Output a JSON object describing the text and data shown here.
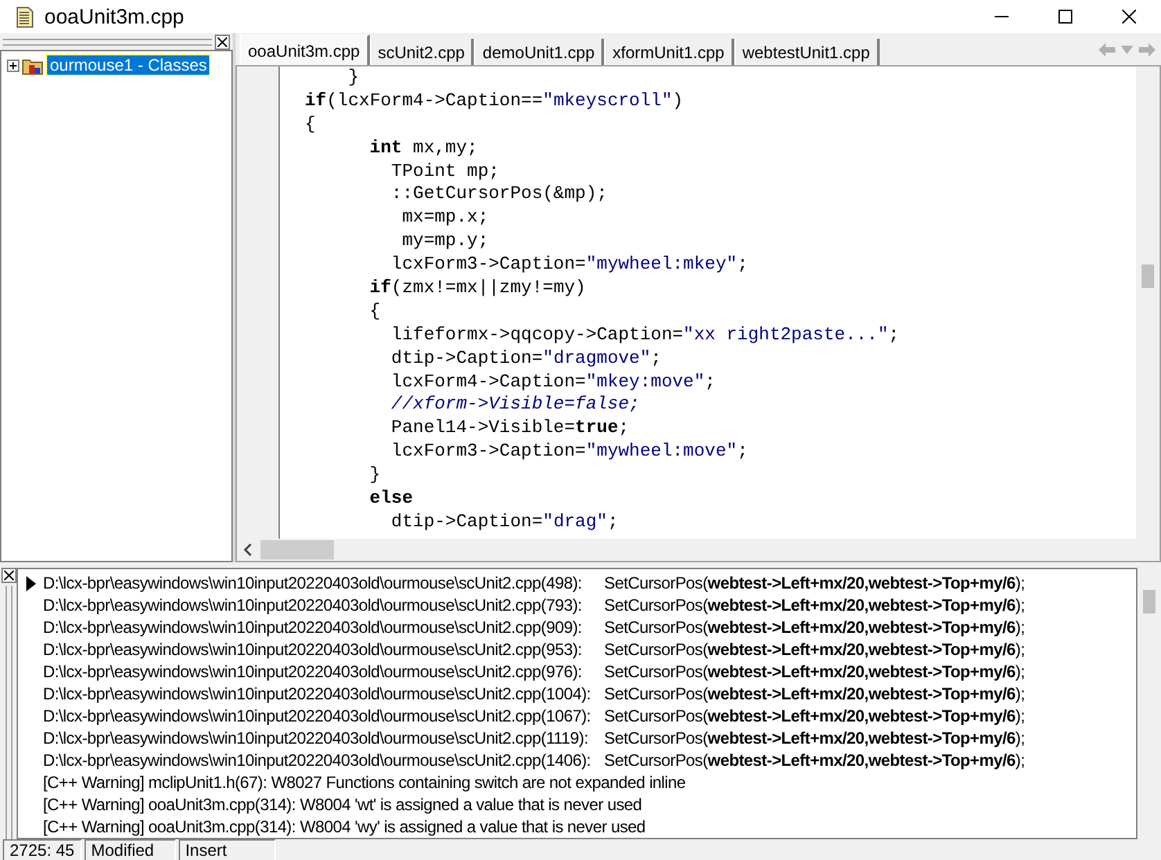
{
  "window": {
    "title": "ooaUnit3m.cpp"
  },
  "class_explorer": {
    "items": [
      {
        "label": "ourmouse1 - Classes",
        "selected": true,
        "expanded": false
      }
    ]
  },
  "tabs": [
    {
      "label": "ooaUnit3m.cpp",
      "selected": true
    },
    {
      "label": "scUnit2.cpp",
      "selected": false
    },
    {
      "label": "demoUnit1.cpp",
      "selected": false
    },
    {
      "label": "xformUnit1.cpp",
      "selected": false
    },
    {
      "label": "webtestUnit1.cpp",
      "selected": false
    }
  ],
  "editor": {
    "lines": [
      [
        {
          "kind": "plain",
          "text": "    }"
        }
      ],
      [
        {
          "kind": "keyword",
          "text": "if"
        },
        {
          "kind": "plain",
          "text": "(lcxForm4->Caption=="
        },
        {
          "kind": "string",
          "text": "\"mkeyscroll\""
        },
        {
          "kind": "plain",
          "text": ")"
        }
      ],
      [
        {
          "kind": "plain",
          "text": "{"
        }
      ],
      [
        {
          "kind": "keyword",
          "text": "      int"
        },
        {
          "kind": "plain",
          "text": " mx,my;"
        }
      ],
      [
        {
          "kind": "plain",
          "text": "        TPoint mp;"
        }
      ],
      [
        {
          "kind": "plain",
          "text": "        ::GetCursorPos(&mp);"
        }
      ],
      [
        {
          "kind": "plain",
          "text": "         mx=mp.x;"
        }
      ],
      [
        {
          "kind": "plain",
          "text": "         my=mp.y;"
        }
      ],
      [
        {
          "kind": "plain",
          "text": "        lcxForm3->Caption="
        },
        {
          "kind": "string",
          "text": "\"mywheel:mkey\""
        },
        {
          "kind": "plain",
          "text": ";"
        }
      ],
      [
        {
          "kind": "keyword",
          "text": "      if"
        },
        {
          "kind": "plain",
          "text": "(zmx!=mx||zmy!=my)"
        }
      ],
      [
        {
          "kind": "plain",
          "text": "      {"
        }
      ],
      [
        {
          "kind": "plain",
          "text": "        lifeformx->qqcopy->Caption="
        },
        {
          "kind": "string",
          "text": "\"xx right2paste...\""
        },
        {
          "kind": "plain",
          "text": ";"
        }
      ],
      [
        {
          "kind": "plain",
          "text": "        dtip->Caption="
        },
        {
          "kind": "string",
          "text": "\"dragmove\""
        },
        {
          "kind": "plain",
          "text": ";"
        }
      ],
      [
        {
          "kind": "plain",
          "text": "        lcxForm4->Caption="
        },
        {
          "kind": "string",
          "text": "\"mkey:move\""
        },
        {
          "kind": "plain",
          "text": ";"
        }
      ],
      [
        {
          "kind": "comment",
          "text": "        //xform->Visible=false;"
        }
      ],
      [
        {
          "kind": "plain",
          "text": "        Panel14->Visible="
        },
        {
          "kind": "keyword",
          "text": "true"
        },
        {
          "kind": "plain",
          "text": ";"
        }
      ],
      [
        {
          "kind": "plain",
          "text": "        lcxForm3->Caption="
        },
        {
          "kind": "string",
          "text": "\"mywheel:move\""
        },
        {
          "kind": "plain",
          "text": ";"
        }
      ],
      [
        {
          "kind": "plain",
          "text": "      }"
        }
      ],
      [
        {
          "kind": "keyword",
          "text": "      else"
        }
      ],
      [
        {
          "kind": "plain",
          "text": "        dtip->Caption="
        },
        {
          "kind": "string",
          "text": "\"drag\""
        },
        {
          "kind": "plain",
          "text": ";"
        }
      ]
    ]
  },
  "messages": [
    {
      "kind": "result",
      "selected": true,
      "file": "D:\\lcx-bpr\\easywindows\\win10input20220403old\\ourmouse\\scUnit2.cpp(498):",
      "code": "SetCursorPos(**webtest->Left+mx/20,webtest->Top+my/6**);"
    },
    {
      "kind": "result",
      "selected": false,
      "file": "D:\\lcx-bpr\\easywindows\\win10input20220403old\\ourmouse\\scUnit2.cpp(793):",
      "code": "SetCursorPos(**webtest->Left+mx/20,webtest->Top+my/6**);"
    },
    {
      "kind": "result",
      "selected": false,
      "file": "D:\\lcx-bpr\\easywindows\\win10input20220403old\\ourmouse\\scUnit2.cpp(909):",
      "code": "SetCursorPos(**webtest->Left+mx/20,webtest->Top+my/6**);"
    },
    {
      "kind": "result",
      "selected": false,
      "file": "D:\\lcx-bpr\\easywindows\\win10input20220403old\\ourmouse\\scUnit2.cpp(953):",
      "code": "SetCursorPos(**webtest->Left+mx/20,webtest->Top+my/6**);"
    },
    {
      "kind": "result",
      "selected": false,
      "file": "D:\\lcx-bpr\\easywindows\\win10input20220403old\\ourmouse\\scUnit2.cpp(976):",
      "code": "SetCursorPos(**webtest->Left+mx/20,webtest->Top+my/6**);"
    },
    {
      "kind": "result",
      "selected": false,
      "file": "D:\\lcx-bpr\\easywindows\\win10input20220403old\\ourmouse\\scUnit2.cpp(1004):",
      "code": "SetCursorPos(**webtest->Left+mx/20,webtest->Top+my/6**);"
    },
    {
      "kind": "result",
      "selected": false,
      "file": "D:\\lcx-bpr\\easywindows\\win10input20220403old\\ourmouse\\scUnit2.cpp(1067):",
      "code": "SetCursorPos(**webtest->Left+mx/20,webtest->Top+my/6**);"
    },
    {
      "kind": "result",
      "selected": false,
      "file": "D:\\lcx-bpr\\easywindows\\win10input20220403old\\ourmouse\\scUnit2.cpp(1119):",
      "code": "SetCursorPos(**webtest->Left+mx/20,webtest->Top+my/6**);"
    },
    {
      "kind": "result",
      "selected": false,
      "file": "D:\\lcx-bpr\\easywindows\\win10input20220403old\\ourmouse\\scUnit2.cpp(1406):",
      "code": "SetCursorPos(**webtest->Left+mx/20,webtest->Top+my/6**);"
    },
    {
      "kind": "warning",
      "selected": false,
      "text": "[C++ Warning] mclipUnit1.h(67): W8027 Functions containing switch are not expanded inline"
    },
    {
      "kind": "warning",
      "selected": false,
      "text": "[C++ Warning] ooaUnit3m.cpp(314): W8004 'wt' is assigned a value that is never used"
    },
    {
      "kind": "warning",
      "selected": false,
      "text": "[C++ Warning] ooaUnit3m.cpp(314): W8004 'wy' is assigned a value that is never used"
    }
  ],
  "status_bar": [
    "2725: 45",
    "Modified",
    "Insert"
  ]
}
